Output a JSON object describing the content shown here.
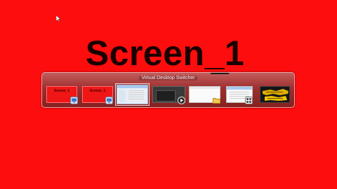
{
  "desktop": {
    "title": "Screen_1",
    "background_color": "#fd0d0d"
  },
  "switcher": {
    "caption": "Virtual Desktop Switcher",
    "thumbnails": [
      {
        "label": "Screen_1",
        "kind": "red-screen",
        "icon": "desktop-monitor-icon"
      },
      {
        "label": "Screen_1",
        "kind": "red-screen",
        "icon": "desktop-monitor-icon"
      },
      {
        "label": "",
        "kind": "explorer-window",
        "icon": "",
        "selected": true
      },
      {
        "label": "",
        "kind": "dark-window",
        "icon": "media-player-icon"
      },
      {
        "label": "",
        "kind": "light-window",
        "icon": "folder-icon"
      },
      {
        "label": "",
        "kind": "list-window",
        "icon": "app-grid-icon"
      },
      {
        "label": "",
        "kind": "game-window",
        "icon": ""
      }
    ]
  }
}
